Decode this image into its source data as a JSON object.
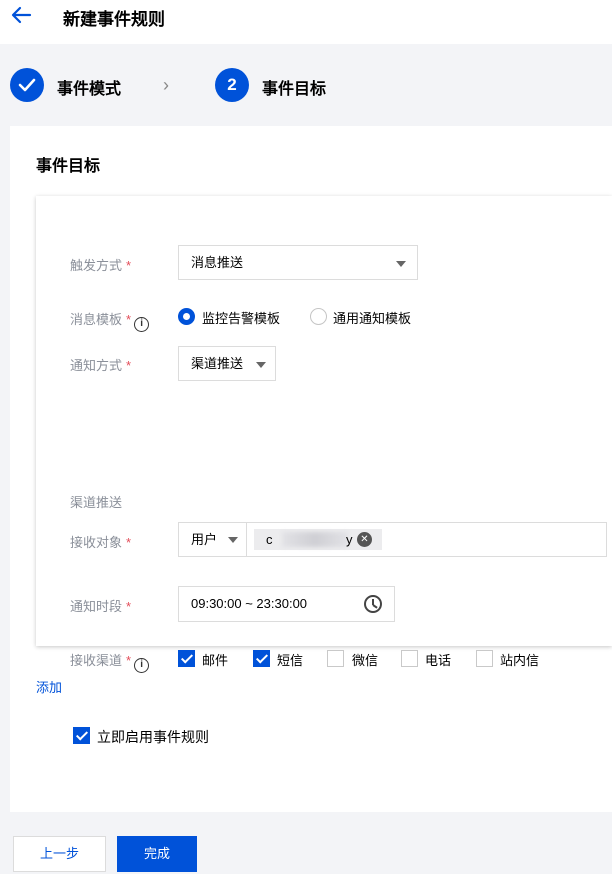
{
  "header": {
    "title": "新建事件规则",
    "back_icon": "arrow-left-icon"
  },
  "steps": [
    {
      "index": "",
      "label": "事件模式",
      "status": "done"
    },
    {
      "index": "2",
      "label": "事件目标",
      "status": "current"
    }
  ],
  "steps_separator": "›",
  "card": {
    "title": "事件目标"
  },
  "form": {
    "trigger": {
      "label": "触发方式",
      "value": "消息推送"
    },
    "template": {
      "label": "消息模板",
      "options": [
        {
          "label": "监控告警模板",
          "checked": true
        },
        {
          "label": "通用通知模板",
          "checked": false
        }
      ]
    },
    "notify_method": {
      "label": "通知方式",
      "value": "渠道推送"
    },
    "section_label": "渠道推送",
    "receiver": {
      "label": "接收对象",
      "type": "用户",
      "tag_prefix": "c",
      "tag_suffix": "y"
    },
    "period": {
      "label": "通知时段",
      "value": "09:30:00 ~ 23:30:00"
    },
    "channels": {
      "label": "接收渠道",
      "options": [
        {
          "label": "邮件",
          "checked": true
        },
        {
          "label": "短信",
          "checked": true
        },
        {
          "label": "微信",
          "checked": false
        },
        {
          "label": "电话",
          "checked": false
        },
        {
          "label": "站内信",
          "checked": false
        }
      ]
    },
    "required_mark": "*",
    "info_glyph": "i"
  },
  "add_link": "添加",
  "enable": {
    "label": "立即启用事件规则",
    "checked": true
  },
  "buttons": {
    "prev": "上一步",
    "done": "完成"
  },
  "colors": {
    "primary": "#0052d9",
    "required": "#e34d59",
    "label_gray": "#8a8f99"
  }
}
